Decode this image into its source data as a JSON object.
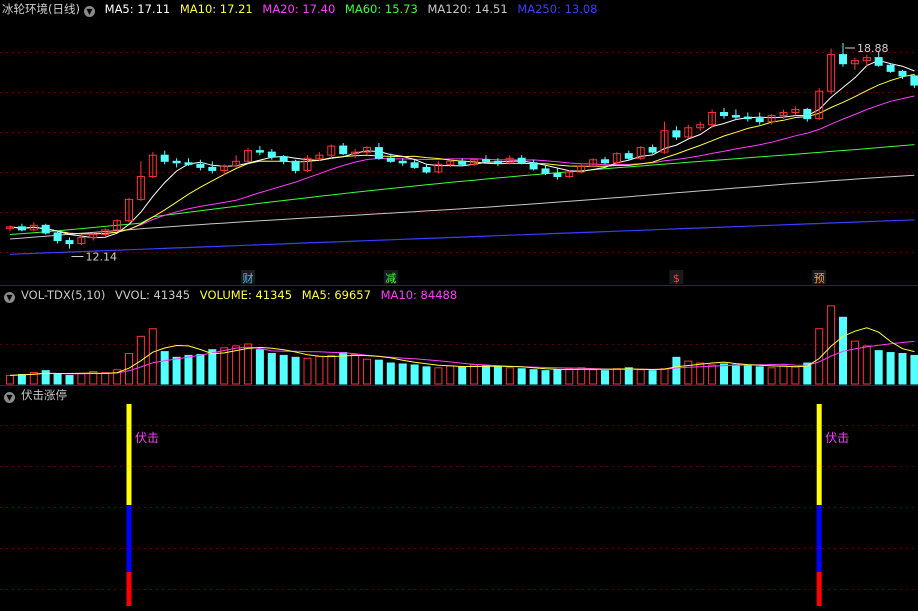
{
  "main_panel": {
    "title": "冰轮环境(日线)",
    "indicators": [
      {
        "label": "MA5: 17.11",
        "color": "#ffffff"
      },
      {
        "label": "MA10: 17.21",
        "color": "#ffff3c"
      },
      {
        "label": "MA20: 17.40",
        "color": "#ff3cff"
      },
      {
        "label": "MA60: 15.73",
        "color": "#3cff3c"
      },
      {
        "label": "MA120: 14.51",
        "color": "#c8c8c8"
      },
      {
        "label": "MA250: 13.08",
        "color": "#3c3cff"
      }
    ],
    "high_label": "18.88",
    "low_label": "12.14",
    "events": [
      {
        "label": "财",
        "color": "#4db8ff",
        "bar": 20
      },
      {
        "label": "减",
        "color": "#3cff3c",
        "bar": 32
      },
      {
        "label": "$",
        "color": "#ff4040",
        "bar": 56
      },
      {
        "label": "预",
        "color": "#ff9933",
        "bar": 68
      }
    ]
  },
  "vol_panel": {
    "title": "VOL-TDX(5,10)",
    "indicators": [
      {
        "label": "VVOL: 41345",
        "color": "#c8c8c8"
      },
      {
        "label": "VOLUME: 41345",
        "color": "#ffff3c"
      },
      {
        "label": "MA5: 69657",
        "color": "#ffff3c"
      },
      {
        "label": "MA10: 84488",
        "color": "#ff3cff"
      }
    ]
  },
  "signal_panel": {
    "title": "伏击涨停",
    "signal_label": "伏击",
    "signal_bars": [
      10,
      68
    ]
  },
  "colors": {
    "up": "#ff3232",
    "down": "#54ffff",
    "frame": "#8b0000",
    "signal_top": "#ffff00",
    "signal_mid": "#0000ff",
    "signal_bot": "#ff0000",
    "signal_text": "#ff3cff"
  },
  "chart_data": {
    "type": "candlestick",
    "title": "冰轮环境(日线)",
    "candles": [
      [
        12.8,
        12.9,
        12.7,
        12.85
      ],
      [
        12.85,
        12.95,
        12.7,
        12.75
      ],
      [
        12.75,
        13.0,
        12.7,
        12.9
      ],
      [
        12.9,
        12.95,
        12.6,
        12.65
      ],
      [
        12.65,
        12.7,
        12.3,
        12.4
      ],
      [
        12.4,
        12.5,
        12.14,
        12.3
      ],
      [
        12.3,
        12.6,
        12.25,
        12.5
      ],
      [
        12.5,
        12.65,
        12.4,
        12.6
      ],
      [
        12.6,
        12.8,
        12.55,
        12.75
      ],
      [
        12.75,
        13.1,
        12.7,
        13.05
      ],
      [
        13.05,
        13.8,
        13.0,
        13.75
      ],
      [
        13.75,
        15.0,
        13.7,
        14.5
      ],
      [
        14.5,
        15.3,
        14.45,
        15.2
      ],
      [
        15.2,
        15.35,
        14.9,
        15.0
      ],
      [
        15.0,
        15.1,
        14.8,
        14.95
      ],
      [
        14.95,
        15.1,
        14.85,
        14.9
      ],
      [
        14.9,
        15.05,
        14.7,
        14.8
      ],
      [
        14.8,
        15.0,
        14.6,
        14.7
      ],
      [
        14.7,
        14.9,
        14.55,
        14.85
      ],
      [
        14.85,
        15.2,
        14.8,
        15.0
      ],
      [
        15.0,
        15.45,
        14.95,
        15.35
      ],
      [
        15.35,
        15.5,
        15.2,
        15.3
      ],
      [
        15.3,
        15.4,
        15.05,
        15.15
      ],
      [
        15.15,
        15.2,
        14.9,
        15.0
      ],
      [
        15.0,
        15.05,
        14.6,
        14.7
      ],
      [
        14.7,
        15.2,
        14.65,
        15.1
      ],
      [
        15.1,
        15.3,
        15.0,
        15.2
      ],
      [
        15.2,
        15.55,
        15.1,
        15.5
      ],
      [
        15.5,
        15.6,
        15.2,
        15.25
      ],
      [
        15.25,
        15.4,
        15.1,
        15.3
      ],
      [
        15.3,
        15.5,
        15.2,
        15.45
      ],
      [
        15.45,
        15.6,
        15.05,
        15.1
      ],
      [
        15.1,
        15.25,
        14.95,
        15.0
      ],
      [
        15.0,
        15.1,
        14.85,
        14.95
      ],
      [
        14.95,
        15.05,
        14.75,
        14.8
      ],
      [
        14.8,
        14.9,
        14.6,
        14.65
      ],
      [
        14.65,
        15.0,
        14.6,
        14.9
      ],
      [
        14.9,
        15.05,
        14.8,
        15.0
      ],
      [
        15.0,
        15.1,
        14.85,
        14.9
      ],
      [
        14.9,
        15.1,
        14.85,
        15.05
      ],
      [
        15.05,
        15.2,
        14.95,
        15.0
      ],
      [
        15.0,
        15.1,
        14.85,
        14.95
      ],
      [
        14.95,
        15.2,
        14.9,
        15.1
      ],
      [
        15.1,
        15.2,
        14.9,
        14.95
      ],
      [
        14.95,
        15.05,
        14.7,
        14.75
      ],
      [
        14.75,
        14.85,
        14.55,
        14.6
      ],
      [
        14.6,
        14.8,
        14.4,
        14.5
      ],
      [
        14.5,
        14.7,
        14.45,
        14.65
      ],
      [
        14.65,
        14.9,
        14.6,
        14.85
      ],
      [
        14.85,
        15.1,
        14.8,
        15.05
      ],
      [
        15.05,
        15.15,
        14.9,
        14.95
      ],
      [
        14.95,
        15.3,
        14.9,
        15.25
      ],
      [
        15.25,
        15.35,
        15.05,
        15.1
      ],
      [
        15.1,
        15.5,
        15.05,
        15.45
      ],
      [
        15.45,
        15.55,
        15.25,
        15.3
      ],
      [
        15.3,
        16.3,
        15.25,
        16.0
      ],
      [
        16.0,
        16.15,
        15.7,
        15.8
      ],
      [
        15.8,
        16.2,
        15.75,
        16.1
      ],
      [
        16.1,
        16.3,
        16.0,
        16.2
      ],
      [
        16.2,
        16.7,
        16.1,
        16.6
      ],
      [
        16.6,
        16.75,
        16.4,
        16.5
      ],
      [
        16.5,
        16.7,
        16.35,
        16.45
      ],
      [
        16.45,
        16.6,
        16.3,
        16.4
      ],
      [
        16.4,
        16.6,
        16.2,
        16.3
      ],
      [
        16.3,
        16.55,
        16.2,
        16.5
      ],
      [
        16.5,
        16.7,
        16.4,
        16.6
      ],
      [
        16.6,
        16.8,
        16.5,
        16.7
      ],
      [
        16.7,
        16.75,
        16.3,
        16.4
      ],
      [
        16.4,
        17.4,
        16.35,
        17.3
      ],
      [
        17.3,
        18.7,
        17.2,
        18.5
      ],
      [
        18.5,
        18.88,
        18.1,
        18.2
      ],
      [
        18.2,
        18.4,
        18.0,
        18.3
      ],
      [
        18.3,
        18.5,
        18.1,
        18.4
      ],
      [
        18.4,
        18.6,
        18.1,
        18.15
      ],
      [
        18.15,
        18.2,
        17.9,
        17.95
      ],
      [
        17.95,
        18.0,
        17.7,
        17.8
      ],
      [
        17.8,
        17.85,
        17.4,
        17.5
      ]
    ],
    "volume": [
      9,
      10,
      12,
      14,
      10,
      9,
      11,
      13,
      12,
      15,
      32,
      50,
      58,
      34,
      28,
      30,
      31,
      36,
      38,
      40,
      42,
      36,
      32,
      30,
      28,
      27,
      29,
      30,
      33,
      31,
      26,
      25,
      22,
      21,
      20,
      18,
      17,
      19,
      18,
      20,
      19,
      18,
      17,
      16,
      15,
      14,
      15,
      16,
      17,
      15,
      14,
      16,
      17,
      15,
      14,
      16,
      28,
      24,
      22,
      20,
      21,
      20,
      19,
      18,
      17,
      19,
      18,
      22,
      58,
      82,
      70,
      45,
      40,
      35,
      33,
      32,
      30
    ],
    "y_range": [
      11.5,
      19.7
    ],
    "volume_max": 85
  }
}
